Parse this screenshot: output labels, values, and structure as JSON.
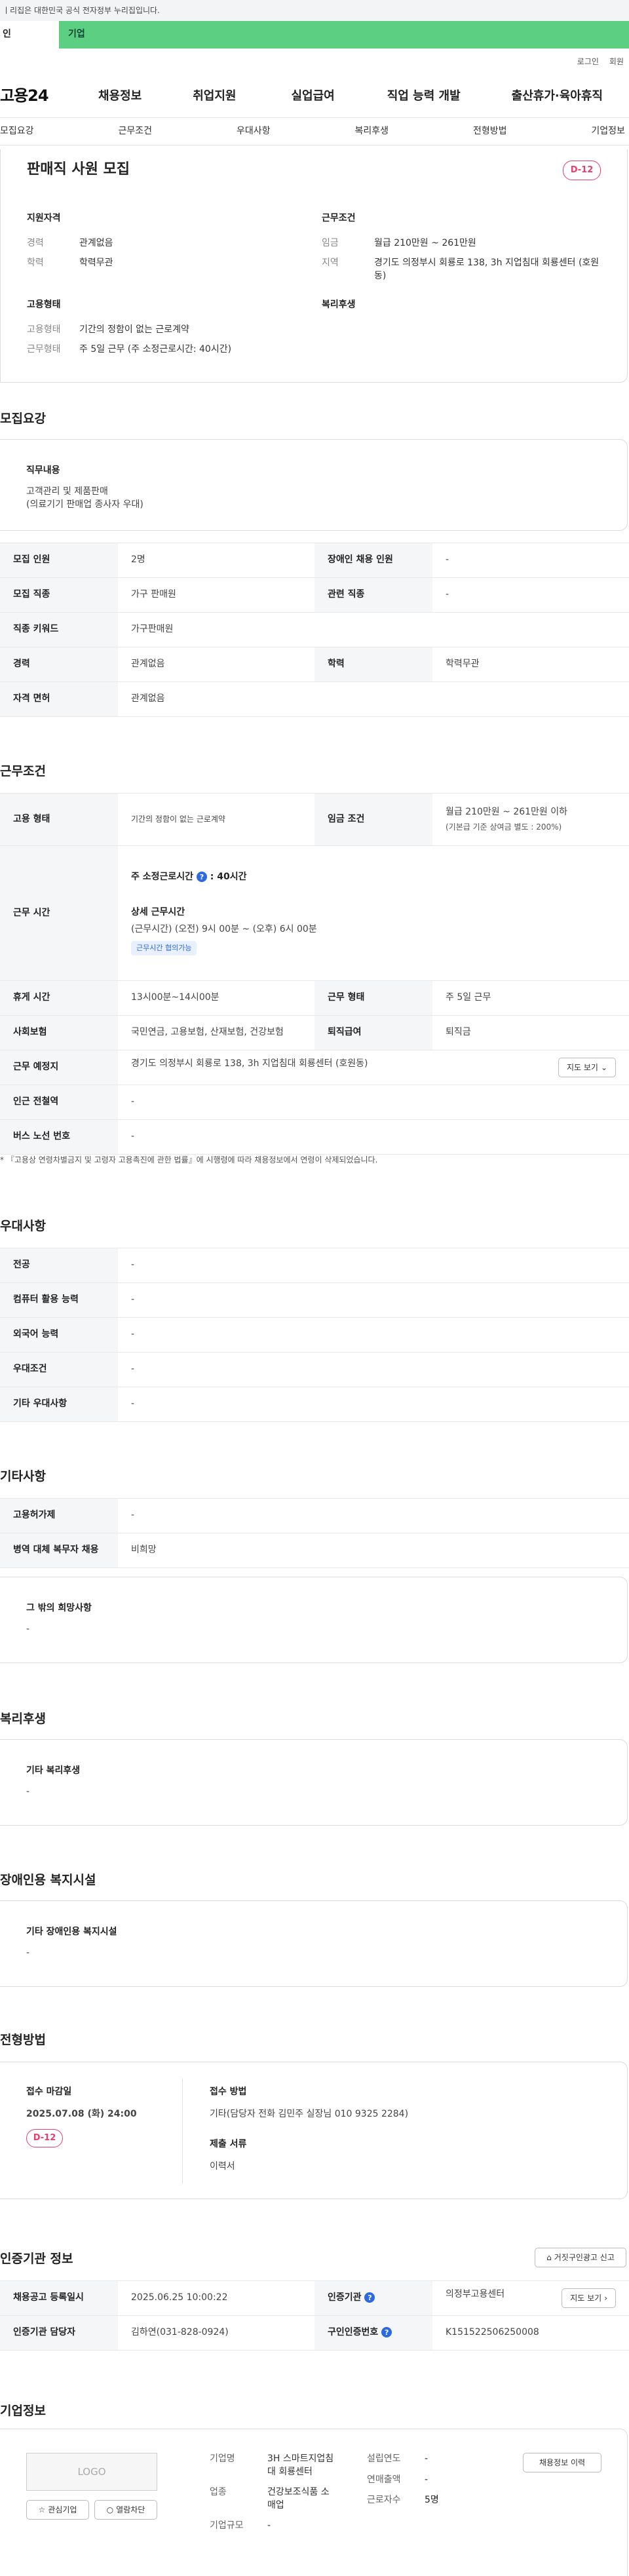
{
  "gov_banner": "ㅣ리집은 대한민국 공식 전자정부 누리집입니다.",
  "segments": {
    "a": "인",
    "b": "기업"
  },
  "util": {
    "login": "로그인",
    "join": "회원"
  },
  "logo": "고용24",
  "gnb": [
    "채용정보",
    "취업지원",
    "실업급여",
    "직업 능력 개발",
    "출산휴가·육아휴직"
  ],
  "tabs": [
    "모집요강",
    "근무조건",
    "우대사항",
    "복리후생",
    "전형방법",
    "기업정보"
  ],
  "header": {
    "title": "판매직 사원 모집",
    "dday": "D-12",
    "qual_title": "지원자격",
    "career_k": "경력",
    "career_v": "관계없음",
    "edu_k": "학력",
    "edu_v": "학력무관",
    "cond_title": "근무조건",
    "wage_k": "임금",
    "wage_v": "월급 210만원 ~ 261만원",
    "region_k": "지역",
    "region_v": "경기도 의정부시 회룡로 138, 3h 지업침대 회룡센터 (호원동)",
    "emp_title": "고용형태",
    "emp_k": "고용형태",
    "emp_v": "기간의 정함이 없는 근로계약",
    "shape_k": "근무형태",
    "shape_v": "주 5일 근무 (주 소정근로시간: 40시간)",
    "welfare_title": "복리후생"
  },
  "recruit": {
    "section": "모집요강",
    "duty_title": "직무내용",
    "duty_l1": "고객관리 및 제품판매",
    "duty_l2": "(의료기기 판매업 종사자 우대)",
    "r1k1": "모집 인원",
    "r1v1": "2명",
    "r1k2": "장애인 채용 인원",
    "r1v2": "-",
    "r2k1": "모집 직종",
    "r2v1": "가구 판매원",
    "r2k2": "관련 직종",
    "r2v2": "-",
    "r3k1": "직종 키워드",
    "r3v1": "가구판매원",
    "r4k1": "경력",
    "r4v1": "관계없음",
    "r4k2": "학력",
    "r4v2": "학력무관",
    "r5k1": "자격 면허",
    "r5v1": "관계없음"
  },
  "work": {
    "section": "근무조건",
    "w1k1": "고용 형태",
    "w1v1": "기간의 정함이 없는 근로계약",
    "w1k2": "임금 조건",
    "w1v2a": "월급 210만원 ~ 261만원 이하",
    "w1v2b": "(기본급 기준 상여금 별도 : 200%)",
    "w2k": "근무 시간",
    "w2a": "주 소정근로시간",
    "w2a_val": ": 40시간",
    "w2b": "상세 근무시간",
    "w2c": "(근무시간) (오전) 9시 00분 ~ (오후) 6시 00분",
    "w2tag": "근무시간 협의가능",
    "w3k1": "휴게 시간",
    "w3v1": "13시00분~14시00분",
    "w3k2": "근무 형태",
    "w3v2": "주 5일 근무",
    "w4k1": "사회보험",
    "w4v1": "국민연금, 고용보험, 산재보험, 건강보험",
    "w4k2": "퇴직급여",
    "w4v2": "퇴직금",
    "w5k": "근무 예정지",
    "w5v": "경기도 의정부시 회룡로 138, 3h 지업침대 회룡센터 (호원동)",
    "w5btn": "지도 보기",
    "w6k": "인근 전철역",
    "w6v": "-",
    "w7k": "버스 노선 번호",
    "w7v": "-",
    "note": "* 『고용상 연령차별금지 및 고령자 고용촉진에 관한 법률』에 시행령에 따라 채용정보에서 연령이 삭제되었습니다."
  },
  "pref": {
    "section": "우대사항",
    "rows": [
      {
        "k": "전공",
        "v": "-"
      },
      {
        "k": "컴퓨터 활용 능력",
        "v": "-"
      },
      {
        "k": "외국어 능력",
        "v": "-"
      },
      {
        "k": "우대조건",
        "v": "-"
      },
      {
        "k": "기타 우대사항",
        "v": "-"
      }
    ]
  },
  "etc": {
    "section": "기타사항",
    "r1k": "고용허가제",
    "r1v": "-",
    "r2k": "병역 대체 복무자 채용",
    "r2v": "비희망",
    "box_t": "그 밖의 희망사항",
    "box_v": "-"
  },
  "welfare": {
    "section": "복리후생",
    "box_t": "기타 복리후생",
    "box_v": "-"
  },
  "disab": {
    "section": "장애인용 복지시설",
    "box_t": "기타 장애인용 복지시설",
    "box_v": "-"
  },
  "method": {
    "section": "전형방법",
    "deadline_t": "접수 마감일",
    "deadline_v": "2025.07.08 (화) 24:00",
    "dday": "D-12",
    "apply_t": "접수 방법",
    "apply_v": "기타(담당자 전화 김민주 실장님 010 9325 2284)",
    "docs_t": "제출 서류",
    "docs_v": "이력서"
  },
  "agency": {
    "section": "인증기관 정보",
    "report_btn": "거짓구인광고 신고",
    "r1k1": "채용공고 등록일시",
    "r1v1": "2025.06.25 10:00:22",
    "r1k2": "인증기관",
    "r1v2": "의정부고용센터",
    "r1btn": "지도 보기",
    "r2k1": "인증기관 담당자",
    "r2v1": "김하연(031-828-0924)",
    "r2k2": "구인인증번호",
    "r2v2": "K151522506250008"
  },
  "company": {
    "section": "기업정보",
    "logo": "LOGO",
    "fav": "관심기업",
    "block": "열람차단",
    "name_k": "기업명",
    "name_v1": "3H 스마트지업침",
    "name_v2": "대 회룡센터",
    "ind_k": "업종",
    "ind_v1": "건강보조식품 소",
    "ind_v2": "매업",
    "size_k": "기업규모",
    "size_v": "-",
    "year_k": "설립연도",
    "year_v": "-",
    "sales_k": "연매출액",
    "sales_v": "-",
    "emp_k": "근로자수",
    "emp_v": "5명",
    "jobs_btn": "채용정보 이력"
  }
}
